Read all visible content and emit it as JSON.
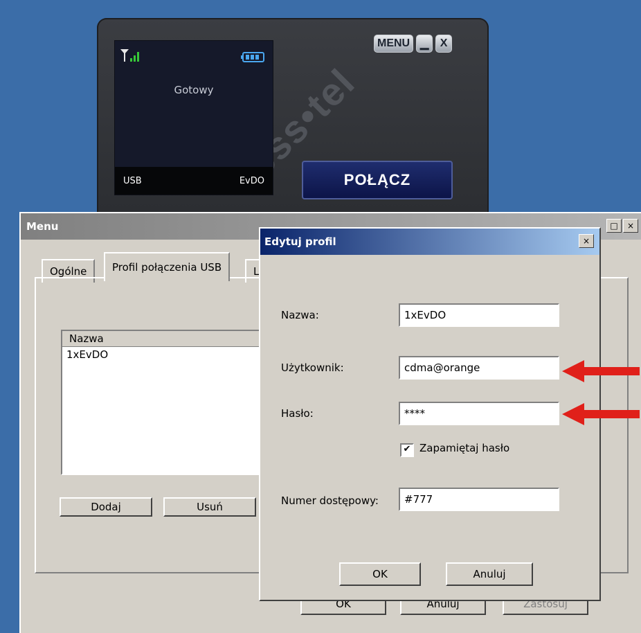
{
  "dialer": {
    "watermark": "xess•tel",
    "menu_label": "MENU",
    "minimize_glyph": "▁",
    "close_glyph": "X",
    "status": "Gotowy",
    "port": "USB",
    "network": "EvDO",
    "connect_label": "POŁĄCZ",
    "icons": [
      "signal-icon",
      "battery-icon"
    ]
  },
  "menu_window": {
    "title": "Menu",
    "tabs": [
      "Ogólne",
      "Profil połączenia USB",
      "L"
    ],
    "list_header": "Nazwa",
    "list_rows": [
      "1xEvDO"
    ],
    "add_label": "Dodaj",
    "remove_label": "Usuń",
    "ok_label": "OK",
    "cancel_label": "Anuluj",
    "apply_label": "Zastosuj"
  },
  "edit_dialog": {
    "title": "Edytuj profil",
    "close_glyph": "×",
    "name_label": "Nazwa:",
    "name_value": "1xEvDO",
    "user_label": "Użytkownik:",
    "user_value": "cdma@orange",
    "password_label": "Hasło:",
    "password_value": "****",
    "remember_checked": true,
    "remember_label": "Zapamiętaj hasło",
    "number_label": "Numer dostępowy:",
    "number_value": "#777",
    "ok_label": "OK",
    "cancel_label": "Anuluj"
  },
  "colors": {
    "desktop": "#3b6da8",
    "arrow": "#e0201a",
    "title_active": "#0a246a"
  }
}
